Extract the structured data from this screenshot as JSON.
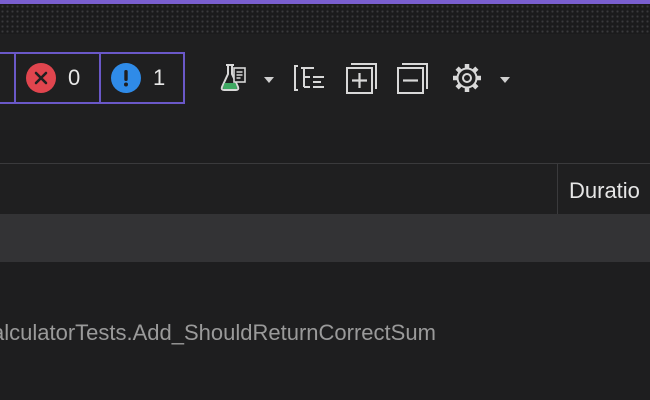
{
  "toolbar": {
    "counters": {
      "errors": {
        "icon": "error-x-icon",
        "count": "0",
        "color": "#e0454e"
      },
      "info": {
        "icon": "info-exclamation-icon",
        "count": "1",
        "color": "#2f8be8"
      }
    },
    "tools": [
      {
        "icon": "flask-test-icon",
        "has_dropdown": true
      },
      {
        "icon": "hierarchy-list-icon",
        "has_dropdown": false
      },
      {
        "icon": "expand-all-icon",
        "has_dropdown": false
      },
      {
        "icon": "collapse-all-icon",
        "has_dropdown": false
      },
      {
        "icon": "gear-icon",
        "has_dropdown": true
      }
    ]
  },
  "table": {
    "columns": {
      "duration": "Duratio"
    }
  },
  "tests": [
    {
      "name": "alculatorTests.Add_ShouldReturnCorrectSum"
    }
  ],
  "colors": {
    "accent": "#7a5fd0",
    "background": "#1e1e1f",
    "selected_row": "#333335"
  }
}
